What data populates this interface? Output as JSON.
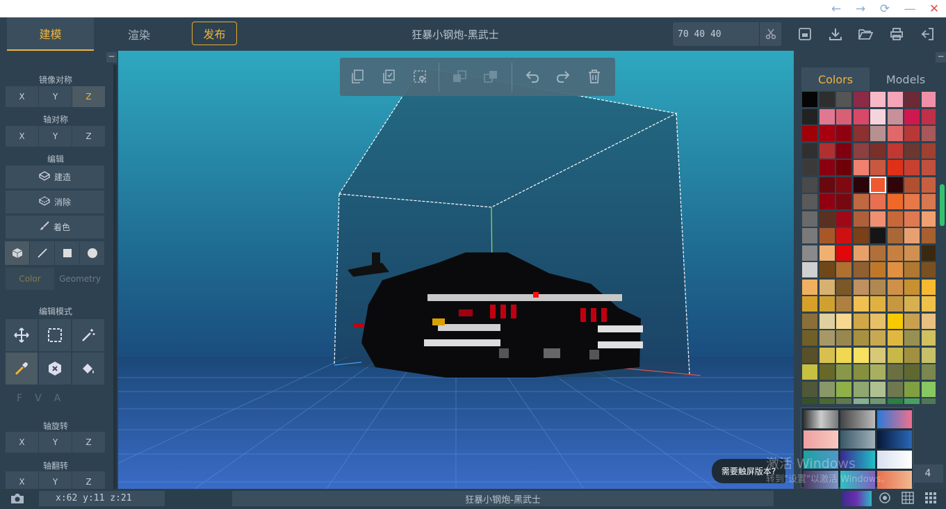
{
  "window": {
    "back_icon": "←",
    "forward_icon": "→",
    "refresh_icon": "⟳",
    "minimize_icon": "—",
    "close_icon": "✕"
  },
  "toolbar": {
    "tab_model": "建模",
    "tab_render": "渲染",
    "publish": "发布",
    "title": "狂暴小钢炮-黑武士",
    "dims": "70 40 40"
  },
  "left": {
    "mirror_title": "镜像对称",
    "mirror": [
      "X",
      "Y",
      "Z"
    ],
    "axis_sym_title": "轴对称",
    "axis_sym": [
      "X",
      "Y",
      "Z"
    ],
    "edit_title": "编辑",
    "build": "建造",
    "erase": "消除",
    "paint": "着色",
    "sub_color": "Color",
    "sub_geometry": "Geometry",
    "edit_mode_title": "编辑模式",
    "fva": [
      "F",
      "V",
      "A"
    ],
    "axis_rot_title": "轴旋转",
    "axis_rot": [
      "X",
      "Y",
      "Z"
    ],
    "axis_flip_title": "轴翻转",
    "axis_flip": [
      "X",
      "Y",
      "Z"
    ]
  },
  "right": {
    "tab_colors": "Colors",
    "tab_models": "Models",
    "page": "4"
  },
  "toast": "需要触屏版本?",
  "watermark": {
    "line1": "激活 Windows",
    "line2": "转到\"设置\"以激活 Windows。"
  },
  "status": {
    "coords": "x:62  y:11  z:21",
    "title": "狂暴小钢炮-黑武士"
  },
  "colors": {
    "accent": "#f0b43c",
    "palette": [
      "#050505",
      "#2e2e2e",
      "#555555",
      "#8c2a48",
      "#f7b8c8",
      "#f3a4b8",
      "#6b2a35",
      "#f090a8",
      "#222222",
      "#e07890",
      "#d86075",
      "#d84868",
      "#f6d4dc",
      "#c89098",
      "#d01850",
      "#c03048",
      "#a00008",
      "#a80010",
      "#900010",
      "#8c3030",
      "#b89090",
      "#e06868",
      "#b83838",
      "#a85858",
      "#303030",
      "#b03030",
      "#800010",
      "#8c4040",
      "#7a3028",
      "#c03830",
      "#6a3830",
      "#a04030",
      "#3a3a3a",
      "#8a0010",
      "#700008",
      "#f08070",
      "#c85840",
      "#e03018",
      "#c84030",
      "#c05040",
      "#4a4a4a",
      "#6a0810",
      "#800810",
      "#2a0408",
      "#f05830",
      "#300408",
      "#b05030",
      "#c86040",
      "#5a5a5a",
      "#900010",
      "#780810",
      "#c06840",
      "#e87050",
      "#f06828",
      "#e87848",
      "#d87850",
      "#6a6a6a",
      "#5a3020",
      "#a00818",
      "#b06038",
      "#f09070",
      "#c86838",
      "#e07850",
      "#f0a070",
      "#7a7a7a",
      "#a85828",
      "#d01010",
      "#7a4018",
      "#151515",
      "#a86838",
      "#e8a070",
      "#a86030",
      "#8a8a8a",
      "#f0b070",
      "#e00808",
      "#e8a068",
      "#b07038",
      "#c88040",
      "#d09050",
      "#3a2810",
      "#d0d0d0",
      "#704818",
      "#b07030",
      "#906030",
      "#c07828",
      "#e09040",
      "#b07830",
      "#7a5020",
      "#f0b060",
      "#d8b070",
      "#7a5828",
      "#c09060",
      "#b08850",
      "#d09048",
      "#c89030",
      "#f8b830",
      "#d8a028",
      "#d0a030",
      "#b08040",
      "#f0c050",
      "#e0b040",
      "#c89840",
      "#d8b050",
      "#f0c048",
      "#8a7038",
      "#e0d0a0",
      "#f8d890",
      "#d0a848",
      "#e8c068",
      "#f8c800",
      "#c8a050",
      "#e8c080",
      "#706028",
      "#a89868",
      "#988850",
      "#a89040",
      "#c8a850",
      "#e0b840",
      "#989050",
      "#d0c060",
      "#585028",
      "#d8c050",
      "#f0d850",
      "#f8e060",
      "#d8c878",
      "#c8b848",
      "#a09040",
      "#c8c068",
      "#c8c040",
      "#686828",
      "#889848",
      "#889040",
      "#a8b060",
      "#6a7040",
      "#606830",
      "#7a8850",
      "#505838",
      "#8a9868",
      "#90b048",
      "#90a870",
      "#b0c090",
      "#707850",
      "#80a040",
      "#88c860",
      "#385028",
      "#4a6a30",
      "#607850",
      "#88b090",
      "#709870",
      "#2a8040",
      "#48a060",
      "#507858",
      "#3a5848",
      "#5a8058",
      "#70a078",
      "#70a898",
      "#90b8a8",
      "#508878",
      "#308870",
      "#00907a"
    ]
  }
}
